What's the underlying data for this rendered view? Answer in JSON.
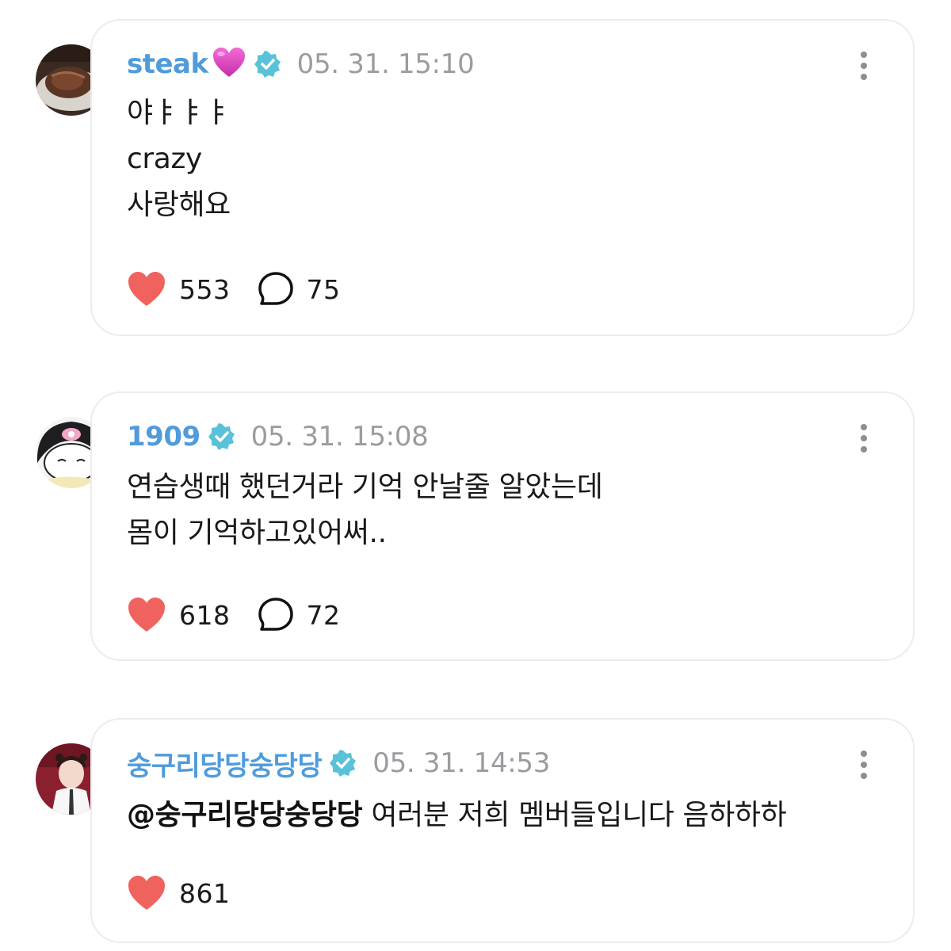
{
  "comments": [
    {
      "username": "steak",
      "name_emoji": "pink-heart-emoji",
      "timestamp": "05. 31. 15:10",
      "lines": [
        "야ㅑㅑㅑ",
        "crazy",
        "사랑해요"
      ],
      "likes": "553",
      "replies": "75",
      "avatar": "steak-photo"
    },
    {
      "username": "1909",
      "timestamp": "05. 31. 15:08",
      "lines": [
        "연습생때 했던거라 기억 안날줄 알았는데",
        "몸이 기억하고있어써.."
      ],
      "likes": "618",
      "replies": "72",
      "avatar": "kuromi-character"
    },
    {
      "username": "숭구리당당숭당당",
      "timestamp": "05. 31. 14:53",
      "mention": "@숭구리당당숭당당",
      "text": " 여러분 저희 멤버들입니다 음하하하",
      "likes": "861",
      "avatar": "user-photo"
    }
  ],
  "colors": {
    "username": "#4f9bdc",
    "timestamp": "#9b9ba0",
    "like_heart": "#f0625d",
    "verified_badge": "#59c1d8",
    "card_border": "#ececef"
  },
  "icons": {
    "verified": "verified-badge-icon",
    "more": "more-vertical-icon",
    "like": "heart-icon",
    "reply": "speech-bubble-icon"
  }
}
